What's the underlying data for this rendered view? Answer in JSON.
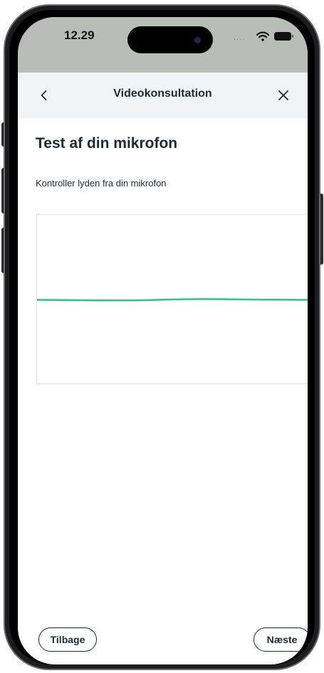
{
  "status_bar": {
    "time": "12.29",
    "signal": "....",
    "icons": [
      "dynamic-island",
      "wifi-icon",
      "battery-icon"
    ],
    "background": "#b8bdb8"
  },
  "nav": {
    "title": "Videokonsultation",
    "back_icon": "chevron-left-icon",
    "close_icon": "close-icon",
    "background": "#f1f4f6"
  },
  "content": {
    "title": "Test af din mikrofon",
    "instruction": "Kontroller lyden fra din mikrofon",
    "waveform_color": "#2bc48a"
  },
  "footer": {
    "back_label": "Tilbage",
    "next_label": "Næste"
  },
  "colors": {
    "text": "#1c2b3a",
    "accent": "#2bc48a"
  }
}
